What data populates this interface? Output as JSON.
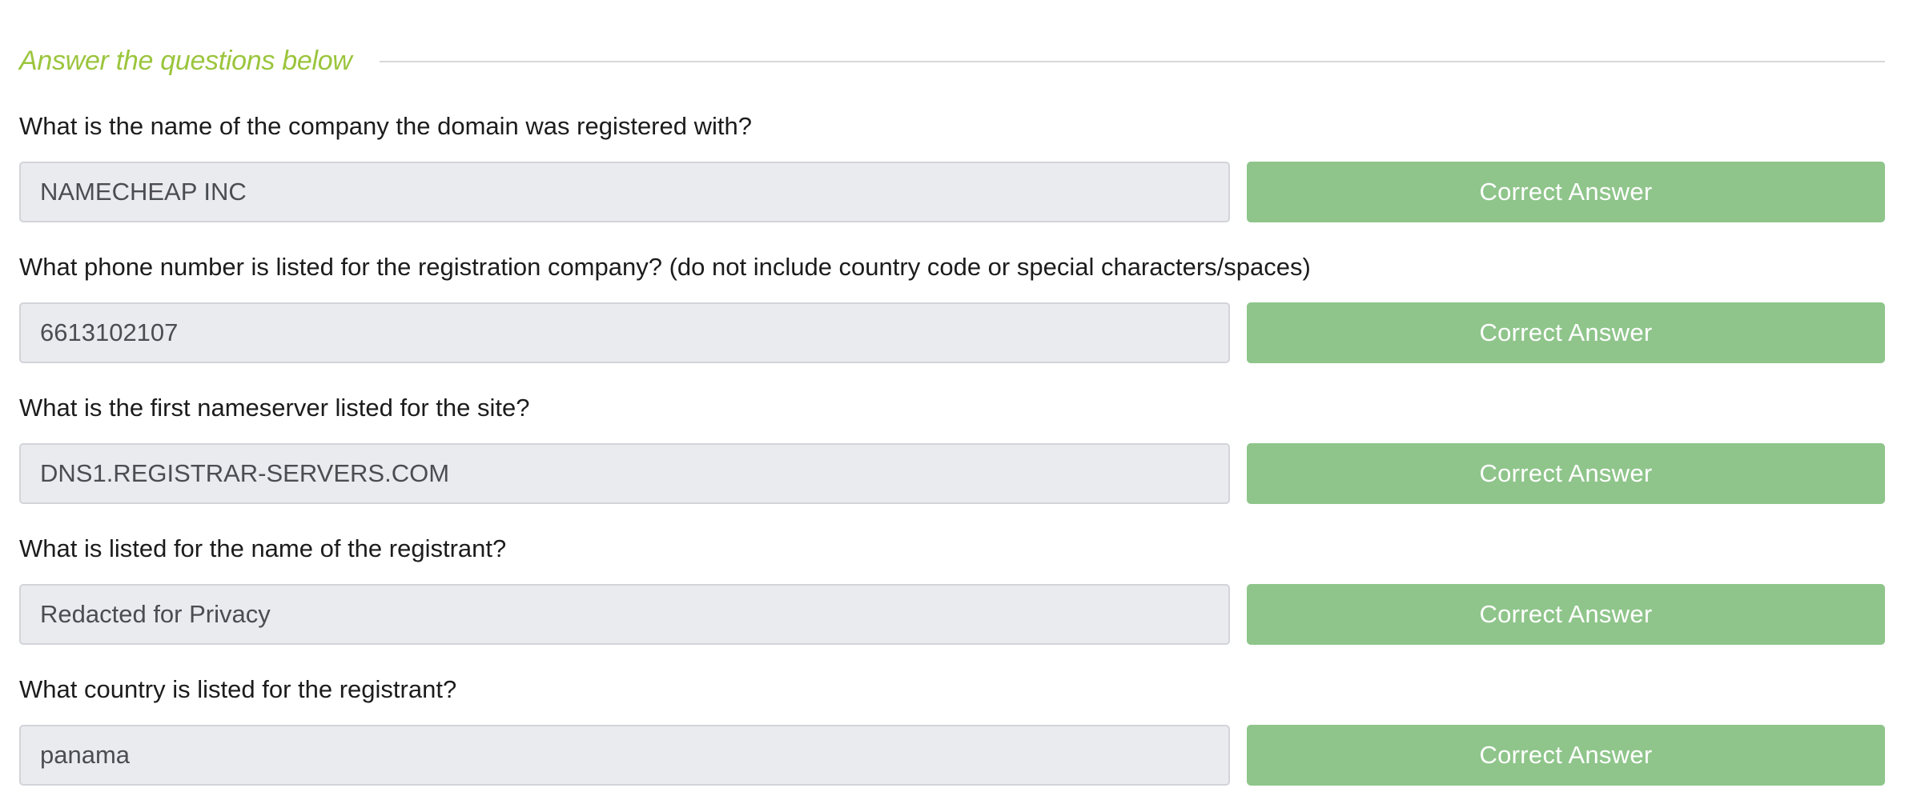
{
  "section": {
    "title": "Answer the questions below"
  },
  "colors": {
    "title_accent": "#9bc53d",
    "correct_button": "#8fc58b",
    "input_background": "#eaebee"
  },
  "questions": [
    {
      "text": "What is the name of the company the domain was registered with?",
      "answer": "NAMECHEAP INC",
      "button_label": "Correct Answer"
    },
    {
      "text": "What phone number is listed for the registration company? (do not include country code or special characters/spaces)",
      "answer": "6613102107",
      "button_label": "Correct Answer"
    },
    {
      "text": "What is the first nameserver listed for the site?",
      "answer": "DNS1.REGISTRAR-SERVERS.COM",
      "button_label": "Correct Answer"
    },
    {
      "text": "What is listed for the name of the registrant?",
      "answer": "Redacted for Privacy",
      "button_label": "Correct Answer"
    },
    {
      "text": "What country is listed for the registrant?",
      "answer": "panama",
      "button_label": "Correct Answer"
    }
  ]
}
